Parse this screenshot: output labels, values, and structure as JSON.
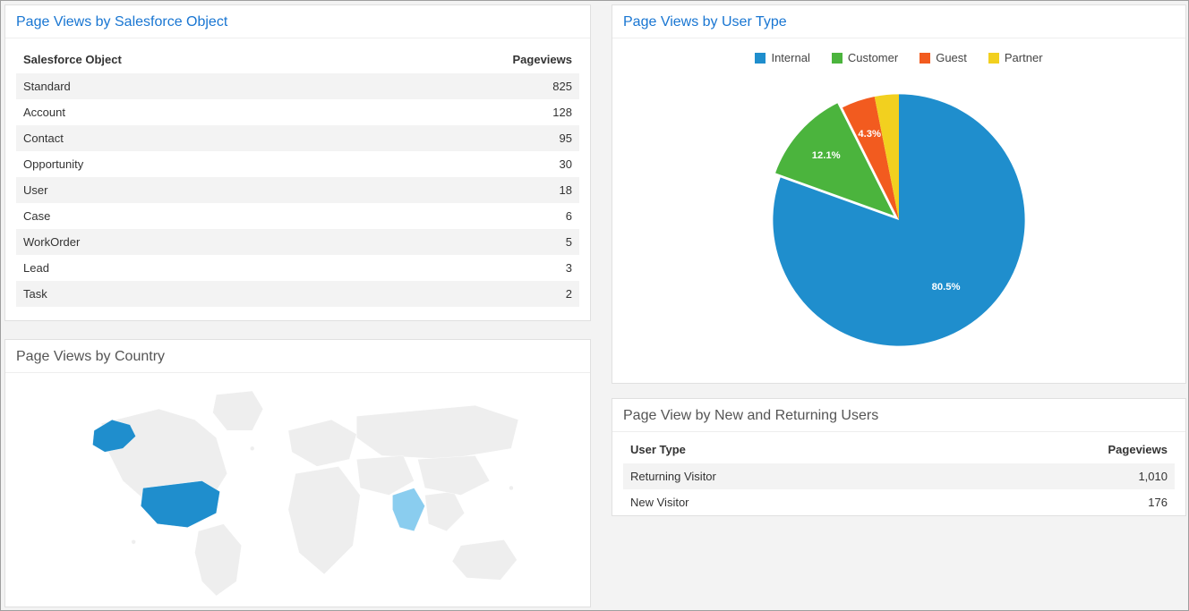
{
  "panels": {
    "sfobj": {
      "title": "Page Views by Salesforce Object",
      "col_object": "Salesforce Object",
      "col_pv": "Pageviews",
      "rows": [
        {
          "name": "Standard",
          "pv": "825"
        },
        {
          "name": "Account",
          "pv": "128"
        },
        {
          "name": "Contact",
          "pv": "95"
        },
        {
          "name": "Opportunity",
          "pv": "30"
        },
        {
          "name": "User",
          "pv": "18"
        },
        {
          "name": "Case",
          "pv": "6"
        },
        {
          "name": "WorkOrder",
          "pv": "5"
        },
        {
          "name": "Lead",
          "pv": "3"
        },
        {
          "name": "Task",
          "pv": "2"
        }
      ]
    },
    "usertype": {
      "title": "Page Views by User Type",
      "legend": [
        {
          "label": "Internal",
          "color": "#1f8ecd"
        },
        {
          "label": "Customer",
          "color": "#4bb43d"
        },
        {
          "label": "Guest",
          "color": "#f25b1f"
        },
        {
          "label": "Partner",
          "color": "#f2d01f"
        }
      ],
      "slice_labels": {
        "internal": "80.5%",
        "customer": "12.1%",
        "guest": "4.3%"
      }
    },
    "country": {
      "title": "Page Views by Country"
    },
    "visitors": {
      "title": "Page View by New and Returning Users",
      "col_ut": "User Type",
      "col_pv": "Pageviews",
      "rows": [
        {
          "name": "Returning Visitor",
          "pv": "1,010"
        },
        {
          "name": "New Visitor",
          "pv": "176"
        }
      ]
    }
  },
  "chart_data": [
    {
      "type": "table",
      "title": "Page Views by Salesforce Object",
      "columns": [
        "Salesforce Object",
        "Pageviews"
      ],
      "rows": [
        [
          "Standard",
          825
        ],
        [
          "Account",
          128
        ],
        [
          "Contact",
          95
        ],
        [
          "Opportunity",
          30
        ],
        [
          "User",
          18
        ],
        [
          "Case",
          6
        ],
        [
          "WorkOrder",
          5
        ],
        [
          "Lead",
          3
        ],
        [
          "Task",
          2
        ]
      ]
    },
    {
      "type": "pie",
      "title": "Page Views by User Type",
      "series": [
        {
          "name": "User Type",
          "slices": [
            {
              "label": "Internal",
              "value": 80.5,
              "color": "#1f8ecd"
            },
            {
              "label": "Customer",
              "value": 12.1,
              "color": "#4bb43d"
            },
            {
              "label": "Guest",
              "value": 4.3,
              "color": "#f25b1f"
            },
            {
              "label": "Partner",
              "value": 3.1,
              "color": "#f2d01f"
            }
          ]
        }
      ],
      "labels_shown": [
        "80.5%",
        "12.1%",
        "4.3%"
      ]
    },
    {
      "type": "map",
      "title": "Page Views by Country",
      "note": "Choropleth world map; United States shaded darkest, India shaded lighter; other countries grey (no data visible).",
      "highlighted": [
        {
          "country": "United States",
          "intensity": "high"
        },
        {
          "country": "India",
          "intensity": "medium"
        }
      ]
    },
    {
      "type": "table",
      "title": "Page View by New and Returning Users",
      "columns": [
        "User Type",
        "Pageviews"
      ],
      "rows": [
        [
          "Returning Visitor",
          1010
        ],
        [
          "New Visitor",
          176
        ]
      ]
    }
  ]
}
